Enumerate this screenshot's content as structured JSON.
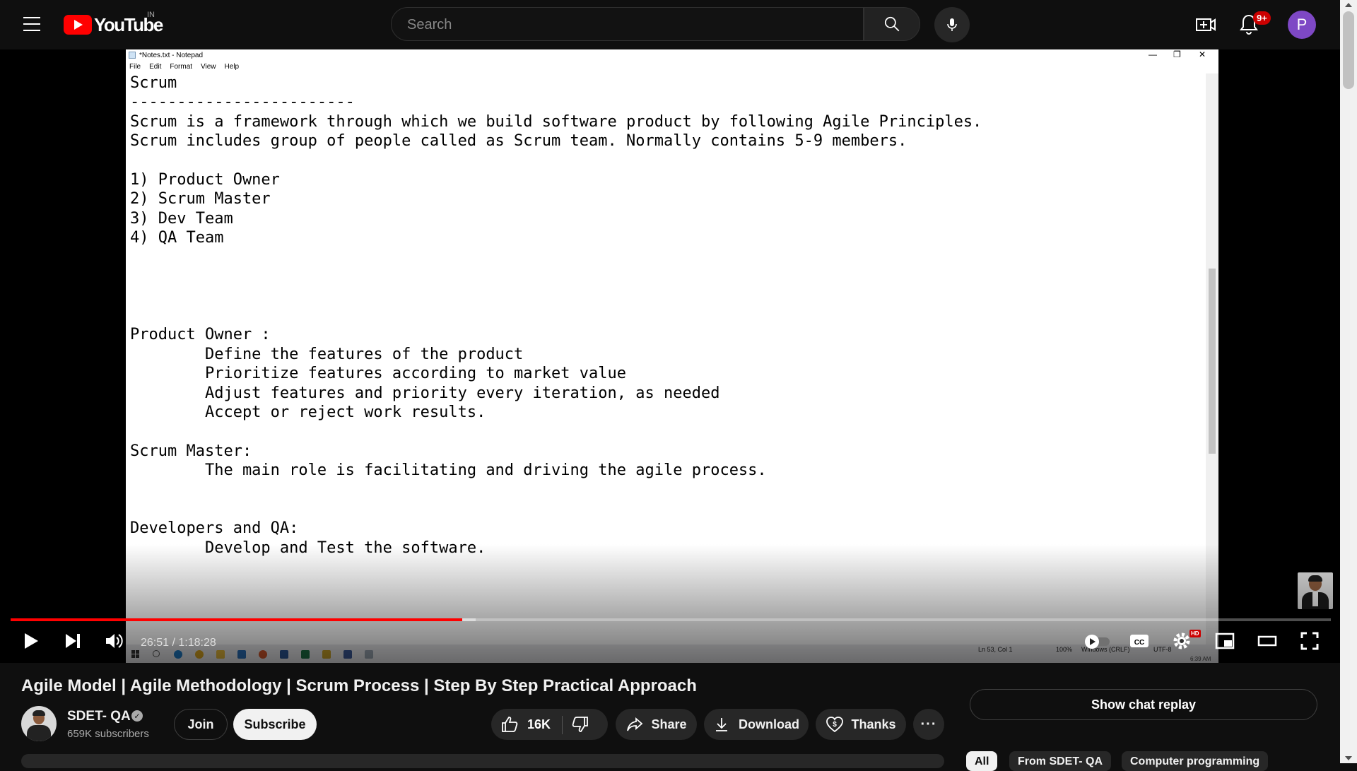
{
  "header": {
    "logo_text": "YouTube",
    "country_code": "IN",
    "search_placeholder": "Search",
    "notification_count": "9+",
    "avatar_letter": "P"
  },
  "notepad": {
    "window_title": "*Notes.txt - Notepad",
    "menu": [
      "File",
      "Edit",
      "Format",
      "View",
      "Help"
    ],
    "content_lines": [
      "Scrum",
      "------------------------",
      "Scrum is a framework through which we build software product by following Agile Principles.",
      "Scrum includes group of people called as Scrum team. Normally contains 5-9 members.",
      "",
      "1) Product Owner",
      "2) Scrum Master",
      "3) Dev Team",
      "4) QA Team",
      "",
      "",
      "",
      "",
      "Product Owner :",
      "        Define the features of the product",
      "        Prioritize features according to market value",
      "        Adjust features and priority every iteration, as needed",
      "        Accept or reject work results.",
      "",
      "Scrum Master:",
      "        The main role is facilitating and driving the agile process.",
      "",
      "",
      "Developers and QA:",
      "        Develop and Test the software."
    ],
    "status_position": "Ln 53, Col 1",
    "status_zoom": "100%",
    "status_eol": "Windows (CRLF)",
    "status_encoding": "UTF-8",
    "taskbar_time": "6:39 AM"
  },
  "player": {
    "current_time": "26:51",
    "duration": "1:18:28",
    "time_display": "26:51 / 1:18:28",
    "progress_played_fraction": 0.342,
    "progress_loaded_fraction": 0.352,
    "hd_badge": "HD"
  },
  "video": {
    "title": "Agile Model | Agile Methodology | Scrum Process | Step By Step Practical Approach",
    "channel_name": "SDET- QA",
    "subscribers": "659K subscribers",
    "join_label": "Join",
    "subscribe_label": "Subscribe",
    "like_count": "16K",
    "share_label": "Share",
    "download_label": "Download",
    "thanks_label": "Thanks",
    "chat_replay_label": "Show chat replay"
  },
  "chips": [
    "All",
    "From SDET- QA",
    "Computer programming"
  ],
  "colors": {
    "background": "#0f0f0f",
    "brand_red": "#ff0000",
    "avatar_purple": "#7e48c5"
  }
}
